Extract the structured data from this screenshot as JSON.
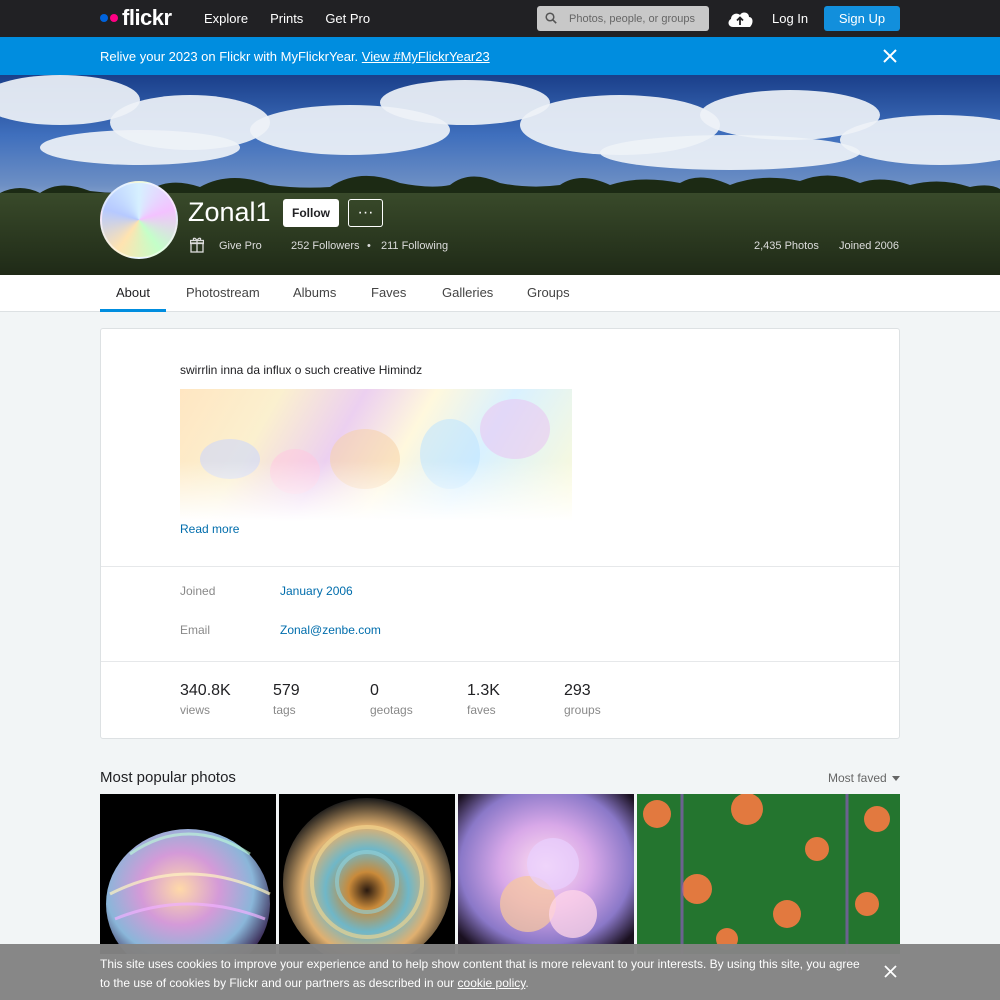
{
  "nav": {
    "logo_text": "flickr",
    "links": [
      "Explore",
      "Prints",
      "Get Pro"
    ],
    "search_placeholder": "Photos, people, or groups",
    "login": "Log In",
    "signup": "Sign Up"
  },
  "banner": {
    "text": "Relive your 2023 on Flickr with MyFlickrYear.",
    "link": "View #MyFlickrYear23"
  },
  "profile": {
    "username": "Zonal1",
    "follow": "Follow",
    "more": "···",
    "give_pro": "Give Pro",
    "followers": "252 Followers",
    "bullet": "•",
    "following": "211 Following",
    "photos": "2,435 Photos",
    "joined": "Joined 2006"
  },
  "tabs": [
    "About",
    "Photostream",
    "Albums",
    "Faves",
    "Galleries",
    "Groups"
  ],
  "about": {
    "description": "swirrlin inna da influx o such creative Himindz",
    "read_more": "Read more",
    "joined_label": "Joined",
    "joined_value": "January 2006",
    "email_label": "Email",
    "email_value": "Zonal@zenbe.com",
    "stats": [
      {
        "value": "340.8K",
        "label": "views"
      },
      {
        "value": "579",
        "label": "tags"
      },
      {
        "value": "0",
        "label": "geotags"
      },
      {
        "value": "1.3K",
        "label": "faves"
      },
      {
        "value": "293",
        "label": "groups"
      }
    ]
  },
  "popular": {
    "title": "Most popular photos",
    "sort": "Most faved"
  },
  "cookie": {
    "text": "This site uses cookies to improve your experience and to help show content that is more relevant to your interests. By using this site, you agree to the use of cookies by Flickr and our partners as described in our",
    "link": "cookie policy",
    "end": "."
  },
  "colors": {
    "nav_bg": "#212124",
    "banner_bg": "#008ddf",
    "signup_bg": "#128fdc",
    "link": "#006dac",
    "tab_active": "#008ddf",
    "cookie_bg": "#848484"
  }
}
